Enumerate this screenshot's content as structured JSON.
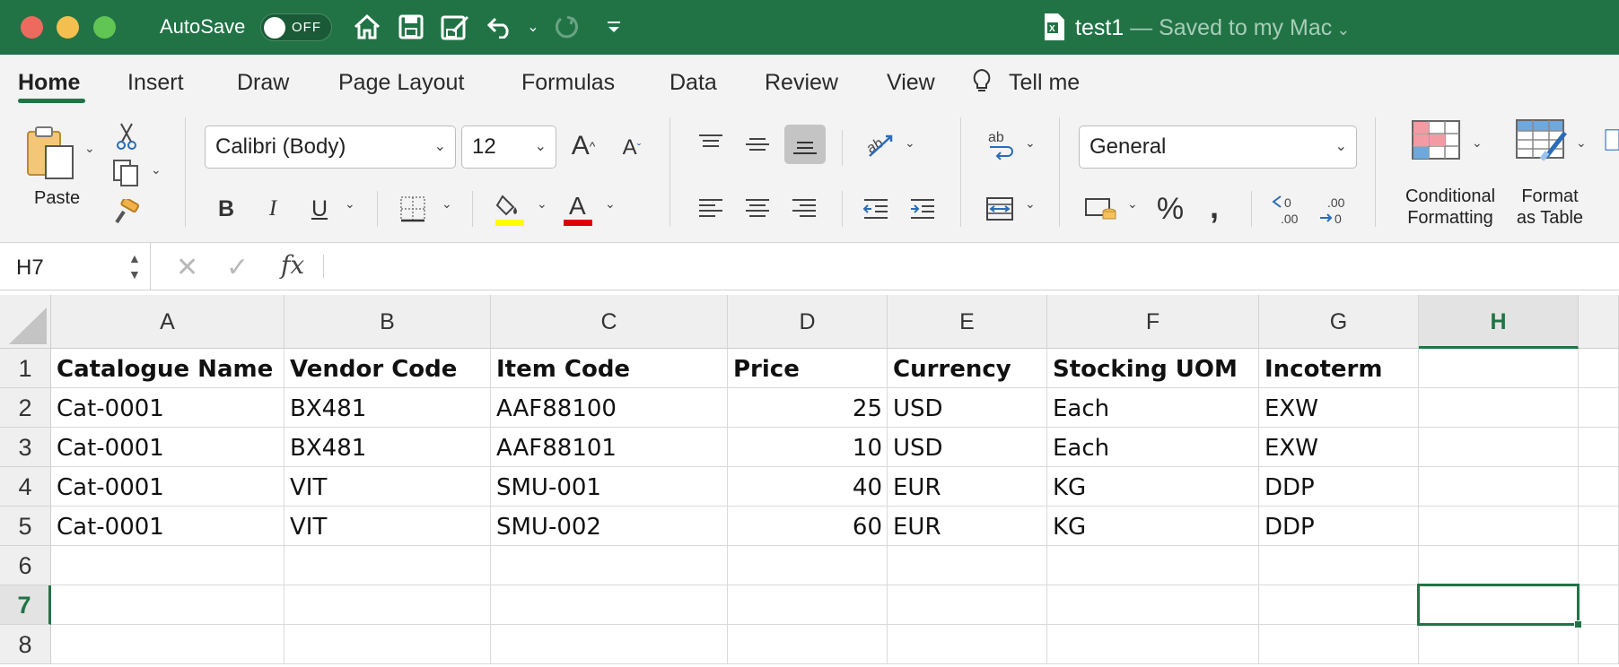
{
  "app": {
    "autosave_label": "AutoSave",
    "autosave_state": "OFF",
    "doc_name": "test1",
    "doc_status": " — Saved to my Mac"
  },
  "tabs": [
    "Home",
    "Insert",
    "Draw",
    "Page Layout",
    "Formulas",
    "Data",
    "Review",
    "View",
    "Tell me"
  ],
  "active_tab": "Home",
  "ribbon": {
    "paste_label": "Paste",
    "font_name": "Calibri (Body)",
    "font_size": "12",
    "number_format": "General",
    "conditional_formatting": [
      "Conditional",
      "Formatting"
    ],
    "format_as_table": [
      "Format",
      "as Table"
    ],
    "bold": "B",
    "italic": "I",
    "underline": "U",
    "highlight_color": "#ffff00",
    "font_color": "#e00000"
  },
  "formula_bar": {
    "name_box": "H7",
    "fx": "fx",
    "formula": ""
  },
  "sheet": {
    "columns": [
      "A",
      "B",
      "C",
      "D",
      "E",
      "F",
      "G",
      "H"
    ],
    "row_numbers": [
      "1",
      "2",
      "3",
      "4",
      "5",
      "6",
      "7",
      "8"
    ],
    "selected_cell": "H7",
    "selected_column": "H",
    "selected_row": "7",
    "rows": [
      [
        "Catalogue Name",
        "Vendor Code",
        "Item Code",
        "Price",
        "Currency",
        "Stocking UOM",
        "Incoterm",
        ""
      ],
      [
        "Cat-0001",
        "BX481",
        "AAF88100",
        "25",
        "USD",
        "Each",
        "EXW",
        ""
      ],
      [
        "Cat-0001",
        "BX481",
        "AAF88101",
        "10",
        "USD",
        "Each",
        "EXW",
        ""
      ],
      [
        "Cat-0001",
        "VIT",
        "SMU-001",
        "40",
        "EUR",
        "KG",
        "DDP",
        ""
      ],
      [
        "Cat-0001",
        "VIT",
        "SMU-002",
        "60",
        "EUR",
        "KG",
        "DDP",
        ""
      ],
      [
        "",
        "",
        "",
        "",
        "",
        "",
        "",
        ""
      ],
      [
        "",
        "",
        "",
        "",
        "",
        "",
        "",
        ""
      ],
      [
        "",
        "",
        "",
        "",
        "",
        "",
        "",
        ""
      ]
    ],
    "accent_color": "#217346"
  }
}
